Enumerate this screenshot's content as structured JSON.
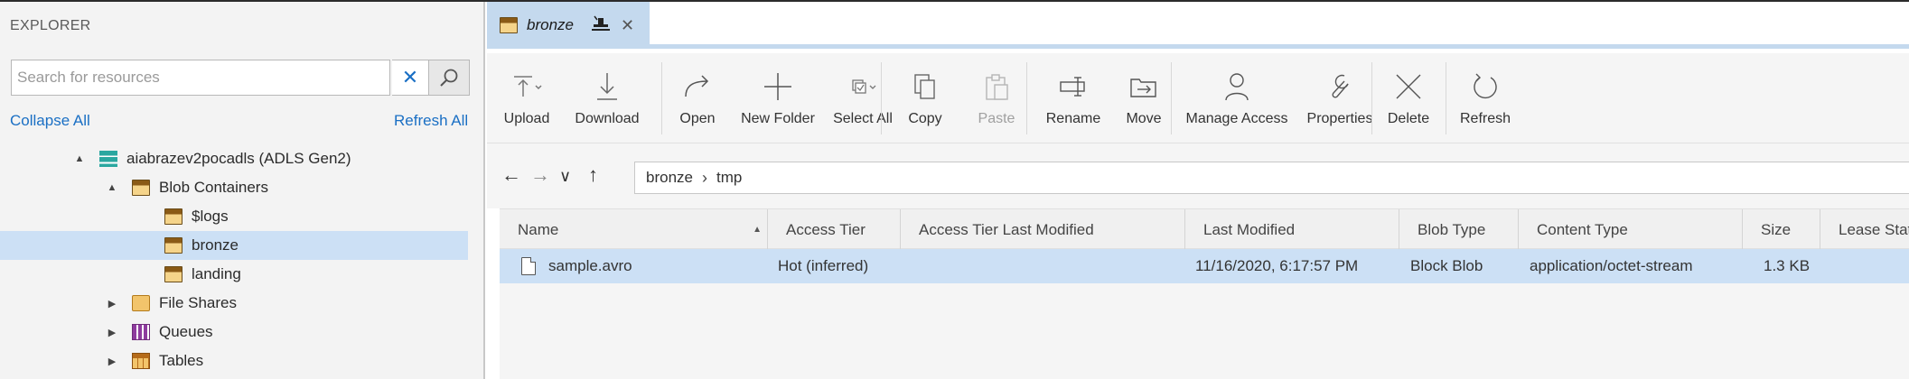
{
  "explorer": {
    "title": "EXPLORER",
    "search": {
      "placeholder": "Search for resources",
      "value": ""
    },
    "collapse_all": "Collapse All",
    "refresh_all": "Refresh All",
    "tree": [
      {
        "label": "aiabrazev2pocadls (ADLS Gen2)",
        "icon": "storage-account-icon",
        "caret": "▲"
      },
      {
        "label": "Blob Containers",
        "icon": "blob-containers-icon",
        "caret": "▲"
      },
      {
        "label": "$logs",
        "icon": "container-icon"
      },
      {
        "label": "bronze",
        "icon": "container-icon",
        "selected": true
      },
      {
        "label": "landing",
        "icon": "container-icon"
      },
      {
        "label": "File Shares",
        "icon": "file-shares-icon",
        "caret": "▶"
      },
      {
        "label": "Queues",
        "icon": "queues-icon",
        "caret": "▶"
      },
      {
        "label": "Tables",
        "icon": "tables-icon",
        "caret": "▶"
      }
    ]
  },
  "tab": {
    "label": "bronze",
    "pin_icon": "pin-icon",
    "close_icon": "close-icon"
  },
  "toolbar": {
    "upload": "Upload",
    "download": "Download",
    "open": "Open",
    "new_folder": "New Folder",
    "select_all": "Select All",
    "copy": "Copy",
    "paste": "Paste",
    "rename": "Rename",
    "move": "Move",
    "manage_access": "Manage Access",
    "properties": "Properties",
    "delete": "Delete",
    "refresh": "Refresh"
  },
  "breadcrumb": {
    "root": "bronze",
    "sub": "tmp"
  },
  "grid": {
    "columns": [
      "Name",
      "Access Tier",
      "Access Tier Last Modified",
      "Last Modified",
      "Blob Type",
      "Content Type",
      "Size",
      "Lease State"
    ],
    "rows": [
      {
        "name": "sample.avro",
        "access_tier": "Hot (inferred)",
        "access_tier_last_modified": "",
        "last_modified": "11/16/2020, 6:17:57 PM",
        "blob_type": "Block Blob",
        "content_type": "application/octet-stream",
        "size": "1.3 KB",
        "lease_state": ""
      }
    ]
  },
  "colors": {
    "accent": "#1a6fc4",
    "selection": "#cce0f5",
    "tab": "#c4d9ee"
  }
}
